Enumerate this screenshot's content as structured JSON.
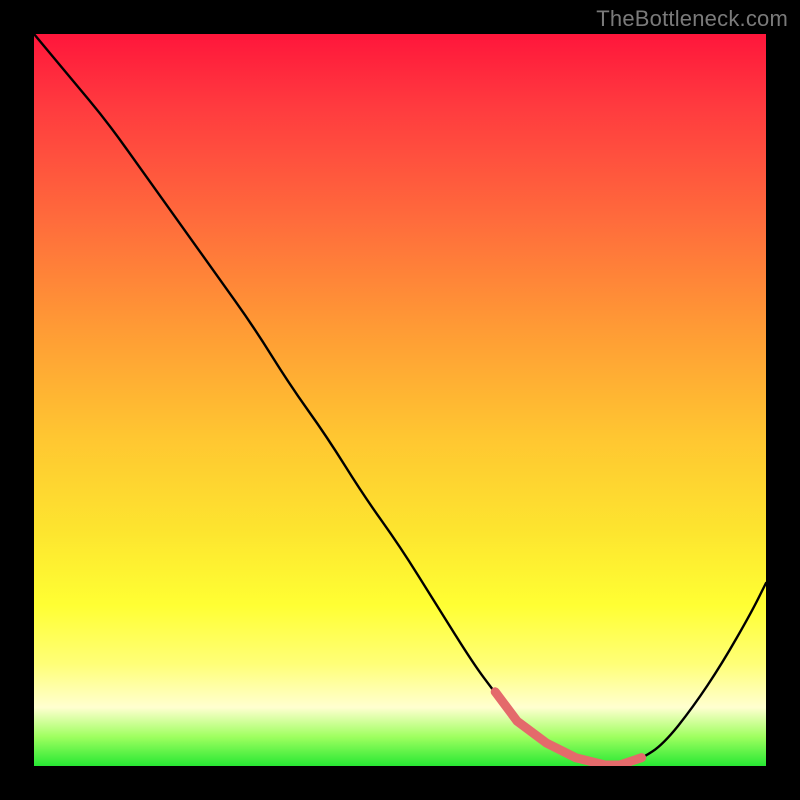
{
  "watermark": "TheBottleneck.com",
  "colors": {
    "frame": "#000000",
    "gradient_top": "#ff163b",
    "gradient_bottom": "#27e833",
    "curve": "#000000",
    "marker": "#e46a6b"
  },
  "chart_data": {
    "type": "line",
    "title": "",
    "xlabel": "",
    "ylabel": "",
    "xlim": [
      0,
      100
    ],
    "ylim": [
      0,
      100
    ],
    "grid": false,
    "series": [
      {
        "name": "bottleneck-curve",
        "x": [
          0,
          5,
          10,
          15,
          20,
          25,
          30,
          35,
          40,
          45,
          50,
          55,
          60,
          63,
          66,
          70,
          74,
          78,
          80,
          83,
          86,
          90,
          94,
          98,
          100
        ],
        "values": [
          100,
          94,
          88,
          81,
          74,
          67,
          60,
          52,
          45,
          37,
          30,
          22,
          14,
          10,
          6,
          3,
          1,
          0,
          0,
          1,
          3,
          8,
          14,
          21,
          25
        ]
      }
    ],
    "flat_region": {
      "x_start": 63,
      "x_end": 83
    },
    "annotations": []
  }
}
